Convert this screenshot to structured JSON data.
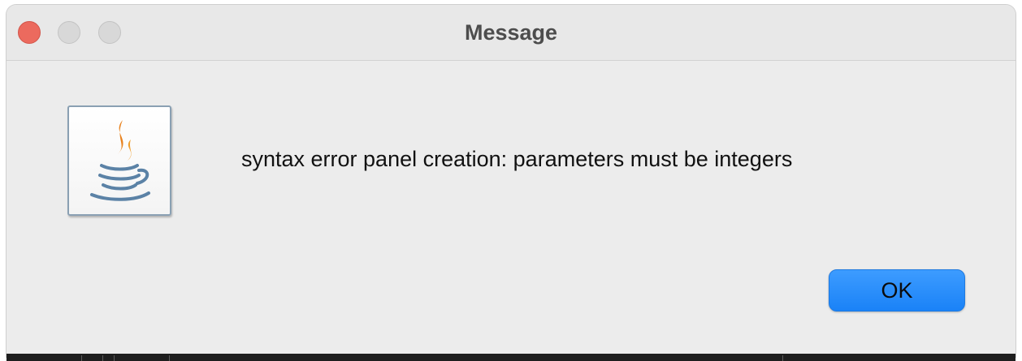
{
  "window": {
    "title": "Message"
  },
  "titlebar": {
    "buttons": [
      "close",
      "minimize",
      "zoom"
    ],
    "colors": {
      "close": "#ec6a5e",
      "inactive": "#d8d8d8"
    }
  },
  "dialog": {
    "icon": "java-coffee-cup-icon",
    "message": "syntax error panel creation: parameters must be integers",
    "ok_label": "OK",
    "accent_color": "#1a82f7"
  }
}
